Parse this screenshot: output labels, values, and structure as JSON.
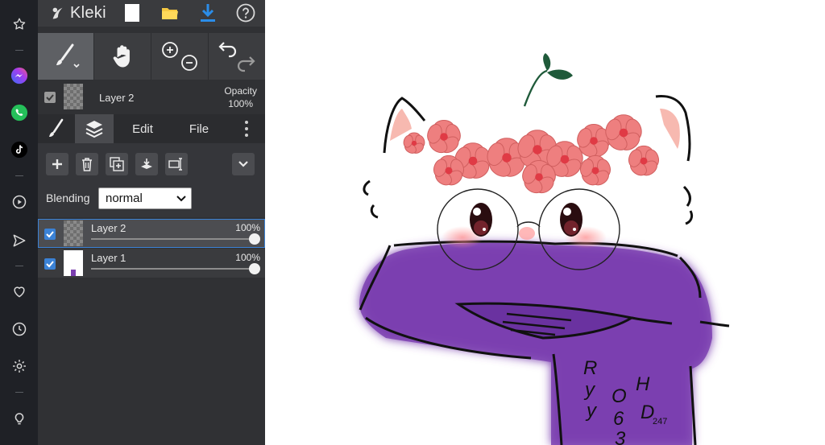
{
  "app": {
    "name": "Kleki"
  },
  "rail": {
    "icons": [
      "star-icon",
      "messenger-icon",
      "whatsapp-icon",
      "tiktok-icon",
      "play-icon",
      "send-icon",
      "heart-icon",
      "clock-icon",
      "settings-icon",
      "lightbulb-icon"
    ]
  },
  "layer_info": {
    "name": "Layer 2",
    "opacity_label": "Opacity",
    "opacity_value": "100%"
  },
  "tabs": {
    "edit": "Edit",
    "file": "File"
  },
  "blending": {
    "label": "Blending",
    "value": "normal"
  },
  "layers": [
    {
      "name": "Layer 2",
      "opacity": "100%",
      "visible": true,
      "selected": true,
      "opacity_fraction": 1.0
    },
    {
      "name": "Layer 1",
      "opacity": "100%",
      "visible": true,
      "selected": false,
      "opacity_fraction": 1.0
    }
  ],
  "artwork": {
    "scarf_text_1": [
      "R",
      "y",
      "y"
    ],
    "scarf_text_2": [
      "O",
      "6",
      "3"
    ],
    "scarf_text_3": [
      "H",
      "D"
    ],
    "scarf_text_small": "247"
  },
  "colors": {
    "accent": "#3b82d6",
    "scarf": "#7b3fb0",
    "flower": "#ee7f7f",
    "leaf": "#1f5a3a"
  }
}
